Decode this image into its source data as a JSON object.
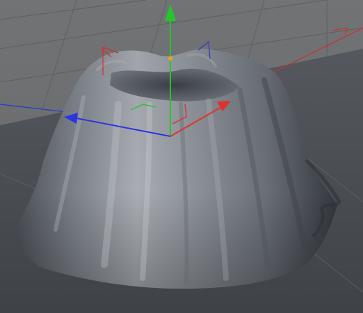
{
  "viewport": {
    "view": "perspective",
    "background_color": "#6b6c6e",
    "floor_color": "#4a4d53",
    "grid_color": "#545659"
  },
  "object": {
    "name": "",
    "shape": "draped-cloth-cone",
    "material_color": "#8b8f96"
  },
  "axes": {
    "x_color": "#e0322c",
    "y_color": "#22c72a",
    "z_color": "#2a36e0",
    "pivot_color": "#f0a020"
  }
}
